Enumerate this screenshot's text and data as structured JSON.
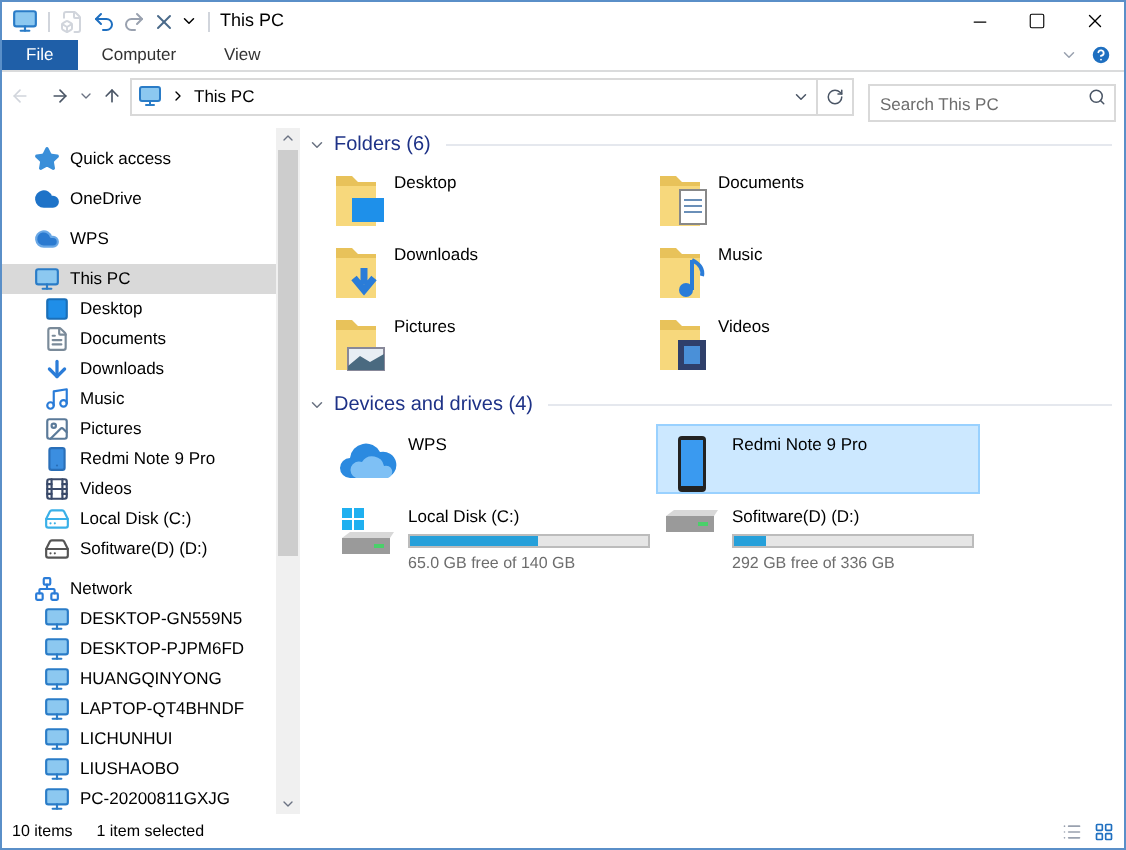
{
  "window": {
    "title": "This PC"
  },
  "ribbon": {
    "tabs": [
      {
        "label": "File",
        "selected": true
      },
      {
        "label": "Computer",
        "selected": false
      },
      {
        "label": "View",
        "selected": false
      }
    ]
  },
  "address": {
    "path": "This PC",
    "back_disabled": true
  },
  "search": {
    "placeholder": "Search This PC"
  },
  "nav": [
    {
      "label": "Quick access",
      "kind": "star",
      "selected": false
    },
    {
      "label": "OneDrive",
      "kind": "cloud",
      "selected": false
    },
    {
      "label": "WPS",
      "kind": "cloud2",
      "selected": false
    },
    {
      "label": "This PC",
      "kind": "pc",
      "selected": true,
      "children": [
        {
          "label": "Desktop",
          "kind": "desktop",
          "selected": false
        },
        {
          "label": "Documents",
          "kind": "documents",
          "selected": false
        },
        {
          "label": "Downloads",
          "kind": "downloads",
          "selected": false
        },
        {
          "label": "Music",
          "kind": "music",
          "selected": false
        },
        {
          "label": "Pictures",
          "kind": "pictures",
          "selected": false
        },
        {
          "label": "Redmi Note 9 Pro",
          "kind": "phone",
          "selected": false
        },
        {
          "label": "Videos",
          "kind": "videos",
          "selected": false
        },
        {
          "label": "Local Disk (C:)",
          "kind": "windisk",
          "selected": false
        },
        {
          "label": "Sofitware(D) (D:)",
          "kind": "disk",
          "selected": false
        }
      ]
    },
    {
      "label": "Network",
      "kind": "network",
      "selected": false,
      "children": [
        {
          "label": "DESKTOP-GN559N5",
          "kind": "computer",
          "selected": false
        },
        {
          "label": "DESKTOP-PJPM6FD",
          "kind": "computer",
          "selected": false
        },
        {
          "label": "HUANGQINYONG",
          "kind": "computer",
          "selected": false
        },
        {
          "label": "LAPTOP-QT4BHNDF",
          "kind": "computer",
          "selected": false
        },
        {
          "label": "LICHUNHUI",
          "kind": "computer",
          "selected": false
        },
        {
          "label": "LIUSHAOBO",
          "kind": "computer",
          "selected": false
        },
        {
          "label": "PC-20200811GXJG",
          "kind": "computer",
          "selected": false
        }
      ]
    }
  ],
  "folders": {
    "title": "Folders (6)",
    "expanded": true,
    "items": [
      {
        "label": "Desktop",
        "kind": "desktop"
      },
      {
        "label": "Documents",
        "kind": "documents"
      },
      {
        "label": "Downloads",
        "kind": "downloads"
      },
      {
        "label": "Music",
        "kind": "music"
      },
      {
        "label": "Pictures",
        "kind": "pictures"
      },
      {
        "label": "Videos",
        "kind": "videos"
      }
    ]
  },
  "drives": {
    "title": "Devices and drives (4)",
    "expanded": true,
    "items": [
      {
        "label": "WPS",
        "kind": "cloud",
        "selected": false
      },
      {
        "label": "Redmi Note 9 Pro",
        "kind": "phone",
        "selected": true
      },
      {
        "label": "Local Disk (C:)",
        "kind": "windisk",
        "selected": false,
        "level": 0.536,
        "free": "65.0 GB free of 140 GB"
      },
      {
        "label": "Sofitware(D) (D:)",
        "kind": "disk",
        "selected": false,
        "level": 0.131,
        "free": "292 GB free of 336 GB"
      }
    ]
  },
  "status_bar": {
    "count": "10 items",
    "selection": "1 item selected",
    "views": [
      {
        "kind": "details",
        "selected": false
      },
      {
        "kind": "large",
        "selected": true
      }
    ]
  }
}
